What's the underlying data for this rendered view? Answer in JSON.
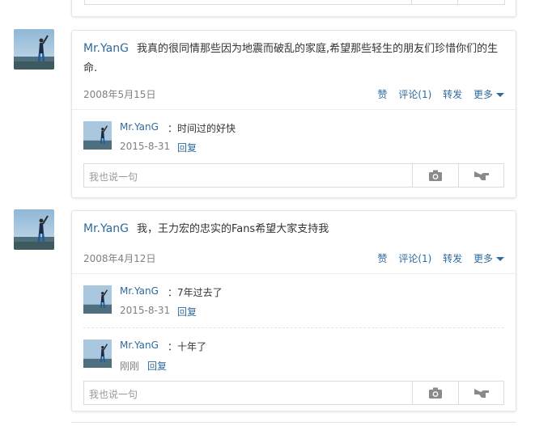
{
  "feed": {
    "posts": [
      {
        "author": "Mr.YanG",
        "text": "我真的很同情那些因为地震而破乱的家庭,希望那些轻生的朋友们珍惜你们的生命.",
        "date": "2008年5月15日",
        "actions": {
          "like": "赞",
          "comment": "评论(1)",
          "share": "转发",
          "more": "更多"
        },
        "replies": [
          {
            "author": "Mr.YanG",
            "text": "：时间过的好快",
            "date": "2015-8-31",
            "reply_label": "回复"
          }
        ],
        "input_placeholder": "我也说一句"
      },
      {
        "author": "Mr.YanG",
        "text": "我，王力宏的忠实的Fans希望大家支持我",
        "date": "2008年4月12日",
        "actions": {
          "like": "赞",
          "comment": "评论(1)",
          "share": "转发",
          "more": "更多"
        },
        "replies": [
          {
            "author": "Mr.YanG",
            "text": "：7年过去了",
            "date": "2015-8-31",
            "reply_label": "回复"
          },
          {
            "author": "Mr.YanG",
            "text": "：十年了",
            "date": "刚刚",
            "reply_label": "回复"
          }
        ],
        "input_placeholder": "我也说一句"
      }
    ]
  },
  "colors": {
    "link": "#2e6a9e",
    "meta": "#808080",
    "border": "#e5e5e5"
  },
  "icons": {
    "camera": "camera-icon",
    "thumb": "thumbs-up-icon",
    "more_caret": "caret-down-icon"
  }
}
